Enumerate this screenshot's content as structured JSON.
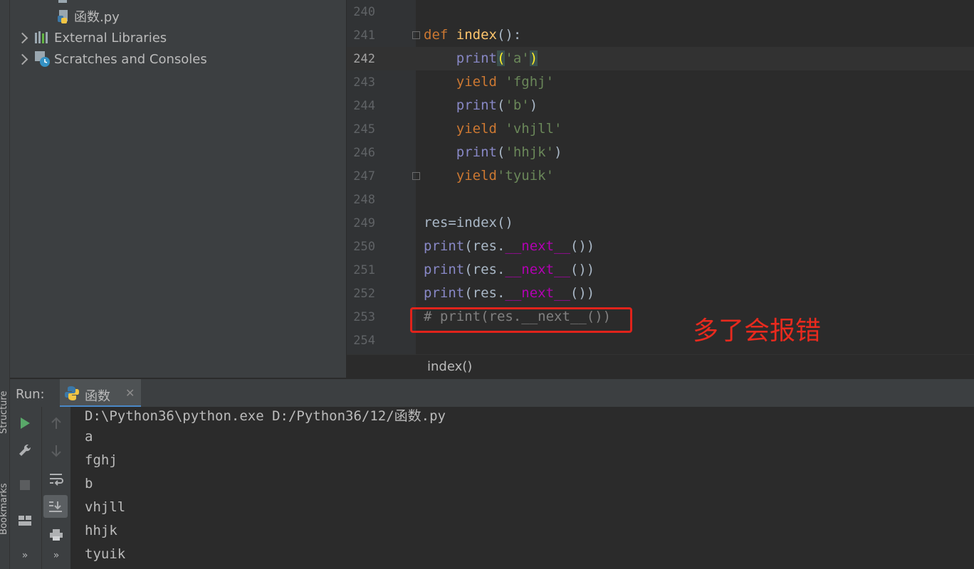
{
  "side_strip": {
    "structure_label": "Structure",
    "bookmarks_label": "Bookmarks"
  },
  "project_tree": {
    "items": [
      {
        "label": "函数.py",
        "icon": "python-file-icon"
      },
      {
        "label": "External Libraries",
        "icon": "library-icon"
      },
      {
        "label": "Scratches and Consoles",
        "icon": "scratches-icon"
      }
    ]
  },
  "editor": {
    "line_numbers": [
      "240",
      "241",
      "242",
      "243",
      "244",
      "245",
      "246",
      "247",
      "248",
      "249",
      "250",
      "251",
      "252",
      "253",
      "254"
    ],
    "current_line": "242",
    "lines": [
      "",
      "def index():",
      "    print('a')",
      "    yield 'fghj'",
      "    print('b')",
      "    yield 'vhjll'",
      "    print('hhjk')",
      "    yield'tyuik'",
      "",
      "res=index()",
      "print(res.__next__())",
      "print(res.__next__())",
      "print(res.__next__())",
      "# print(res.__next__())",
      ""
    ],
    "annotation": "多了会报错",
    "breadcrumb": "index()"
  },
  "run_panel": {
    "label": "Run:",
    "tab_title": "函数",
    "tab_close": "✕",
    "console_lines": [
      "D:\\Python36\\python.exe D:/Python36/12/函数.py",
      "a",
      "fghj",
      "b",
      "vhjll",
      "hhjk",
      "tyuik"
    ],
    "more_glyph": "»"
  },
  "colors": {
    "keyword": "#cc7832",
    "function": "#ffc66d",
    "builtin": "#8888c6",
    "string": "#6a8759",
    "dunder": "#b200b2",
    "comment": "#808080",
    "annotation_red": "#e82a1e"
  }
}
